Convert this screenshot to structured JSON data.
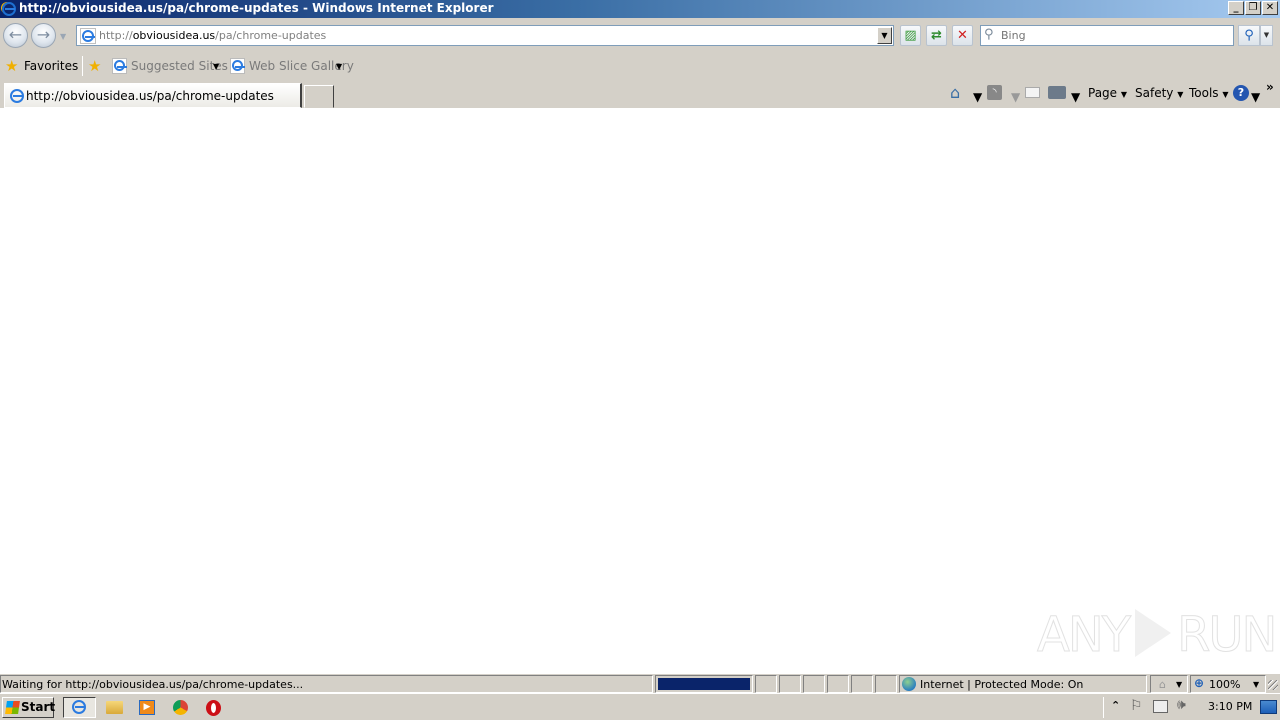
{
  "window": {
    "title": "http://obviousidea.us/pa/chrome-updates - Windows Internet Explorer",
    "controls": {
      "minimize": "_",
      "restore": "❐",
      "close": "✕"
    }
  },
  "navigation": {
    "back_icon": "←",
    "forward_icon": "→",
    "address": {
      "prefix": "http://",
      "domain": "obviousidea.us",
      "path": "/pa/chrome-updates",
      "full": "http://obviousidea.us/pa/chrome-updates"
    },
    "compat_icon": "compatibility-view",
    "refresh_icon": "⇄",
    "stop_icon": "✕",
    "search": {
      "placeholder": "Bing",
      "value": ""
    },
    "search_go_icon": "⚲"
  },
  "favorites_bar": {
    "favorites_label": "Favorites",
    "items": [
      {
        "label": "Suggested Sites",
        "has_dropdown": true
      },
      {
        "label": "Web Slice Gallery",
        "has_dropdown": true
      }
    ]
  },
  "tabs": [
    {
      "label": "http://obviousidea.us/pa/chrome-updates",
      "active": true
    }
  ],
  "command_bar": {
    "home_icon": "home",
    "feeds_icon": "rss",
    "mail_icon": "mail",
    "print_icon": "print",
    "menus": [
      "Page",
      "Safety",
      "Tools"
    ],
    "help_icon": "?",
    "overflow": "»"
  },
  "watermark": {
    "left": "ANY",
    "right": "RUN"
  },
  "status_bar": {
    "text": "Waiting for http://obviousidea.us/pa/chrome-updates...",
    "progress_fraction": 1.0,
    "zone": "Internet | Protected Mode: On",
    "zoom": "100%"
  },
  "taskbar": {
    "start_label": "Start",
    "pinned": [
      "internet-explorer",
      "windows-explorer",
      "media-player",
      "chrome",
      "opera"
    ],
    "tray_expand": "⌃",
    "clock": "3:10 PM"
  },
  "colors": {
    "titlebar_start": "#0a246a",
    "titlebar_end": "#a6caf0",
    "chrome_bg": "#d4d0c8",
    "progress": "#0a246a"
  }
}
